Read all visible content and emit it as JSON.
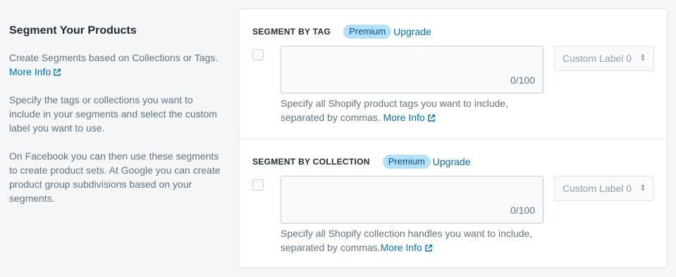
{
  "left": {
    "title": "Segment Your Products",
    "p1_text": "Create Segments based on Collections or Tags.",
    "p1_link": "More Info",
    "p2": "Specify the tags or collections you want to include in your segments and select the custom label you want to use.",
    "p3": "On Facebook you can then use these segments to create product sets. At Google you can create product group subdivisions based on your segments."
  },
  "tag_section": {
    "title": "SEGMENT BY TAG",
    "badge": "Premium",
    "upgrade": "Upgrade",
    "counter": "0/100",
    "select_value": "Custom Label 0",
    "help_text": "Specify all Shopify product tags you want to include, separated by commas.",
    "help_link": "More Info"
  },
  "collection_section": {
    "title": "SEGMENT BY COLLECTION",
    "badge": "Premium",
    "upgrade": "Upgrade",
    "counter": "0/100",
    "select_value": "Custom Label 0",
    "help_text": "Specify all Shopify collection handles you want to include, separated by commas.",
    "help_link": "More Info"
  },
  "icons": {
    "external": "external-link-icon",
    "caret": "select-caret-icon"
  },
  "colors": {
    "link": "#006fbb",
    "badge_bg": "#b4e1fa",
    "badge_text": "#084e8a"
  }
}
